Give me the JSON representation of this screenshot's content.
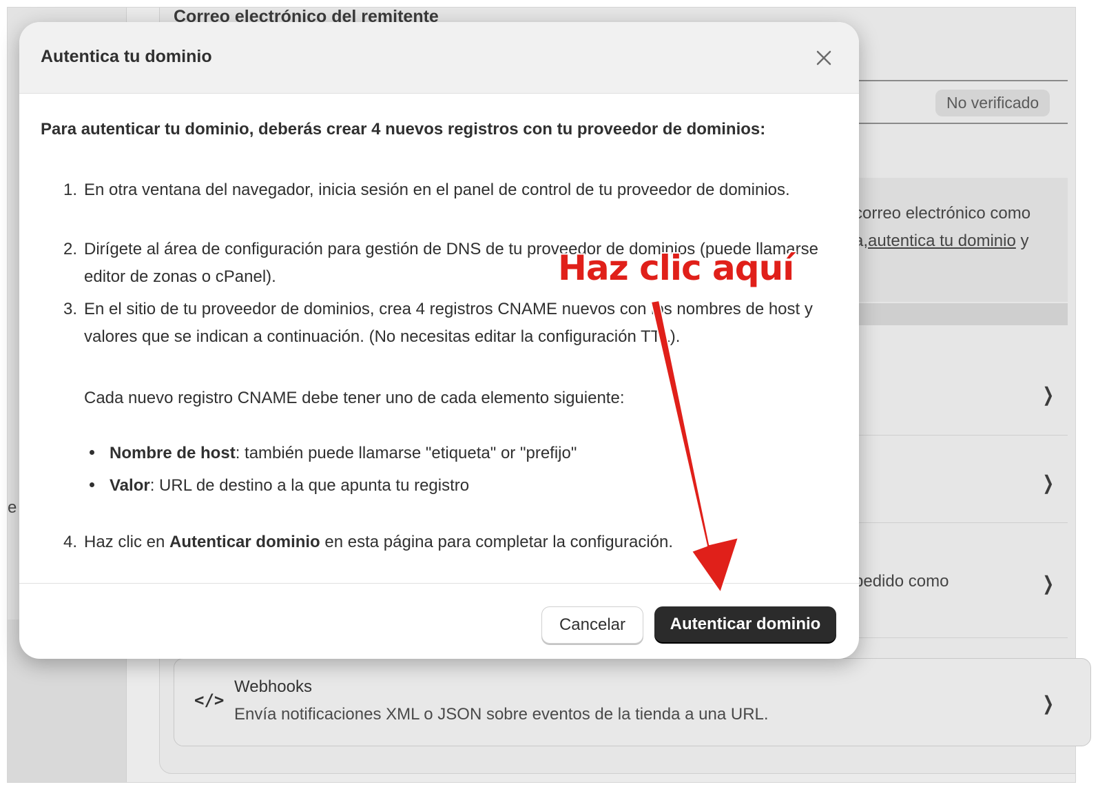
{
  "background": {
    "left_fragment": "e v",
    "sender_label": "Correo electrónico del remitente",
    "badge": "No verificado",
    "info_line1": "correo electrónico como",
    "info_line2_pre": "a,",
    "info_line2_link": "autentica tu dominio",
    "info_line2_post": " y",
    "row3_text": "pedido como",
    "webhooks": {
      "icon": "code-icon",
      "title": "Webhooks",
      "description": "Envía notificaciones XML o JSON sobre eventos de la tienda a una URL."
    }
  },
  "modal": {
    "title": "Autentica tu dominio",
    "intro": "Para autenticar tu dominio, deberás crear 4 nuevos registros con tu proveedor de dominios:",
    "steps": [
      {
        "num": "1.",
        "text": "En otra ventana del navegador, inicia sesión en el panel de control de tu proveedor de dominios."
      },
      {
        "num": "2.",
        "text": "Dirígete al área de configuración para gestión de DNS de tu proveedor de dominios (puede llamarse editor de zonas o cPanel)."
      },
      {
        "num": "3.",
        "text": "En el sitio de tu proveedor de dominios, crea 4 registros CNAME nuevos con los nombres de host y valores que se indican a continuación. (No necesitas editar la configuración TTL)."
      }
    ],
    "cname_intro": "Cada nuevo registro CNAME debe tener uno de cada elemento siguiente:",
    "bullets": [
      {
        "label": "Nombre de host",
        "text": ": también puede llamarse \"etiqueta\" or \"prefijo\""
      },
      {
        "label": "Valor",
        "text": ": URL de destino a la que apunta tu registro"
      }
    ],
    "step4": {
      "num": "4.",
      "pre": "Haz clic en ",
      "bold": "Autenticar dominio",
      "post": " en esta página para completar la configuración."
    },
    "cancel_label": "Cancelar",
    "authenticate_label": "Autenticar dominio"
  },
  "annotation": {
    "text": "Haz clic aquí",
    "color": "#e0201a"
  }
}
